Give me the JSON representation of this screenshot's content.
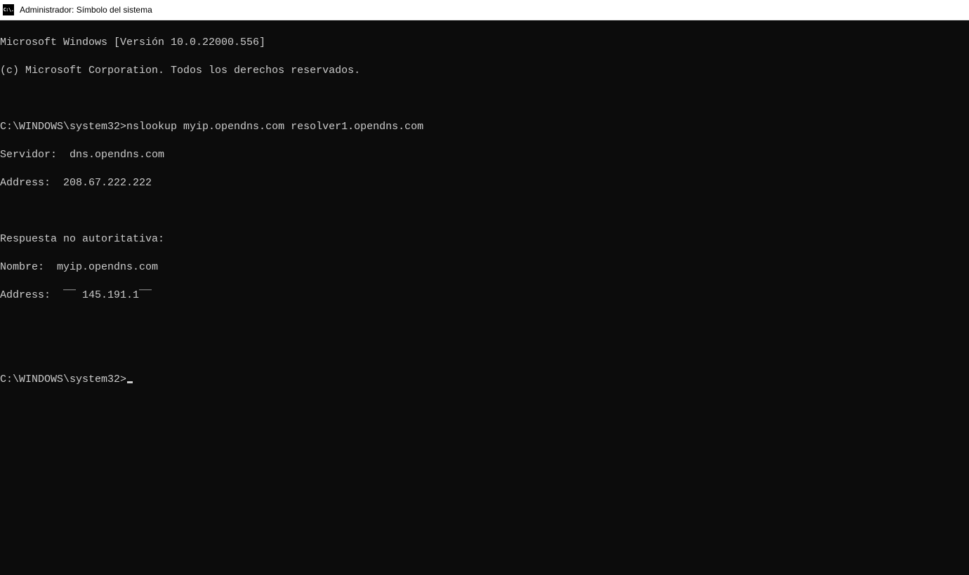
{
  "titlebar": {
    "icon_text": "C:\\.",
    "title": "Administrador: Símbolo del sistema"
  },
  "terminal": {
    "header_line1": "Microsoft Windows [Versión 10.0.22000.556]",
    "header_line2": "(c) Microsoft Corporation. Todos los derechos reservados.",
    "prompt1": "C:\\WINDOWS\\system32>",
    "command1": "nslookup myip.opendns.com resolver1.opendns.com",
    "response_server": "Servidor:  dns.opendns.com",
    "response_address1": "Address:  208.67.222.222",
    "response_nonauth": "Respuesta no autoritativa:",
    "response_name": "Nombre:  myip.opendns.com",
    "response_address2": "Address:  ¯¯ 145.191.1¯¯",
    "prompt2": "C:\\WINDOWS\\system32>"
  }
}
